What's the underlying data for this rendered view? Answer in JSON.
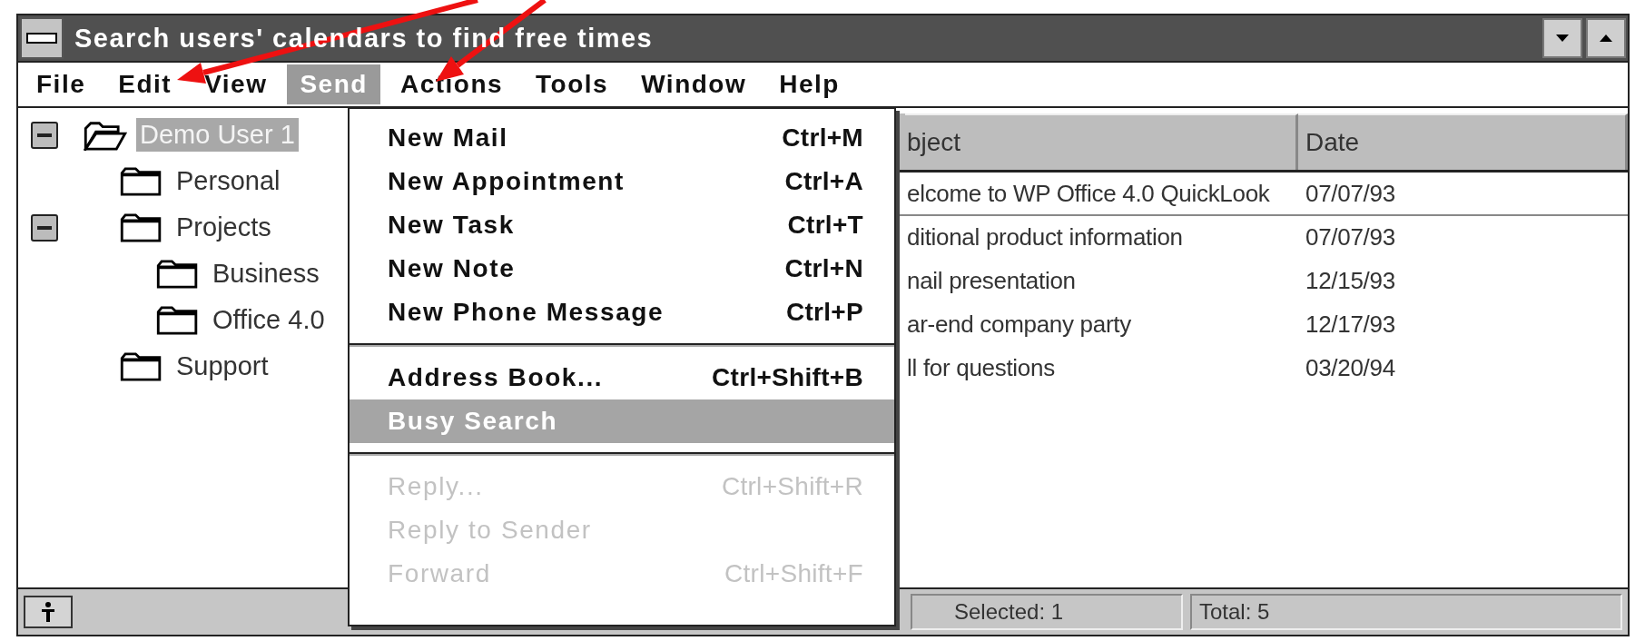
{
  "window": {
    "title": "Search users' calendars to find free times"
  },
  "menu_bar": [
    {
      "label": "File",
      "selected": false
    },
    {
      "label": "Edit",
      "selected": false
    },
    {
      "label": "View",
      "selected": false
    },
    {
      "label": "Send",
      "selected": true
    },
    {
      "label": "Actions",
      "selected": false
    },
    {
      "label": "Tools",
      "selected": false
    },
    {
      "label": "Window",
      "selected": false
    },
    {
      "label": "Help",
      "selected": false
    }
  ],
  "tree": [
    {
      "label": "Demo User 1",
      "selected": true,
      "expanded": true,
      "children": [
        {
          "label": "Personal",
          "selected": false
        },
        {
          "label": "Projects",
          "selected": false,
          "expanded": true,
          "children": [
            {
              "label": "Business",
              "selected": false
            },
            {
              "label": "Office 4.0",
              "selected": false
            }
          ]
        },
        {
          "label": "Support",
          "selected": false
        }
      ]
    }
  ],
  "list": {
    "columns": [
      "bject",
      "Date"
    ],
    "rows": [
      {
        "cells": [
          "elcome to WP Office 4.0 QuickLook",
          "07/07/93"
        ],
        "focused": true
      },
      {
        "cells": [
          "ditional product information",
          "07/07/93"
        ],
        "focused": false
      },
      {
        "cells": [
          "nail presentation",
          "12/15/93"
        ],
        "focused": false
      },
      {
        "cells": [
          "ar-end company party",
          "12/17/93"
        ],
        "focused": false
      },
      {
        "cells": [
          "ll for questions",
          "03/20/94"
        ],
        "focused": false
      }
    ]
  },
  "send_menu": [
    {
      "kind": "item",
      "label": "New Mail",
      "shortcut": "Ctrl+M",
      "disabled": false,
      "selected": false
    },
    {
      "kind": "item",
      "label": "New Appointment",
      "shortcut": "Ctrl+A",
      "disabled": false,
      "selected": false
    },
    {
      "kind": "item",
      "label": "New Task",
      "shortcut": "Ctrl+T",
      "disabled": false,
      "selected": false
    },
    {
      "kind": "item",
      "label": "New Note",
      "shortcut": "Ctrl+N",
      "disabled": false,
      "selected": false
    },
    {
      "kind": "item",
      "label": "New Phone Message",
      "shortcut": "Ctrl+P",
      "disabled": false,
      "selected": false
    },
    {
      "kind": "separator"
    },
    {
      "kind": "item",
      "label": "Address Book...",
      "shortcut": "Ctrl+Shift+B",
      "disabled": false,
      "selected": false
    },
    {
      "kind": "item",
      "label": "Busy Search",
      "disabled": false,
      "selected": true
    },
    {
      "kind": "separator"
    },
    {
      "kind": "item",
      "label": "Reply...",
      "shortcut": "Ctrl+Shift+R",
      "disabled": true,
      "selected": false
    },
    {
      "kind": "item",
      "label": "Reply to Sender",
      "disabled": true,
      "selected": false
    },
    {
      "kind": "item",
      "label": "Forward",
      "shortcut": "Ctrl+Shift+F",
      "disabled": true,
      "selected": false
    }
  ],
  "status_bar": [
    "Selected: 1",
    "Total: 5"
  ]
}
